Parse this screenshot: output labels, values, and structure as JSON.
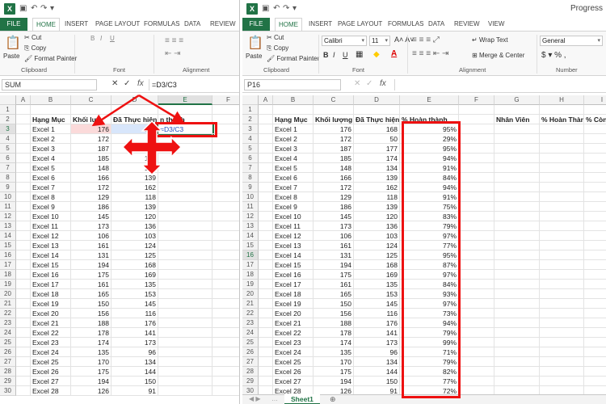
{
  "left": {
    "qa": [
      "↶",
      "↷",
      "▾"
    ],
    "tabs": [
      "FILE",
      "HOME",
      "INSERT",
      "PAGE LAYOUT",
      "FORMULAS",
      "DATA",
      "REVIEW"
    ],
    "clipboard": {
      "cut": "Cut",
      "copy": "Copy",
      "format_painter": "Format Painter",
      "paste": "Paste",
      "label": "Clipboard",
      "font_label": "Font"
    },
    "namebox": "SUM",
    "formula": "=D3/C3",
    "edit_text": "=D3/C3",
    "cols": [
      "A",
      "B",
      "C",
      "D",
      "E",
      "F"
    ],
    "header_row": [
      "Hạng Mục",
      "Khối lư",
      "Đã Thực hiện",
      "n thành"
    ],
    "alignment_label": "Alignment"
  },
  "right": {
    "title": "Progress",
    "tabs": [
      "FILE",
      "HOME",
      "INSERT",
      "PAGE LAYOUT",
      "FORMULAS",
      "DATA",
      "REVIEW",
      "VIEW"
    ],
    "clipboard": {
      "cut": "Cut",
      "copy": "Copy",
      "format_painter": "Format Painter",
      "paste": "Paste",
      "label": "Clipboard"
    },
    "font": {
      "name": "Calibri",
      "size": "11",
      "label": "Font",
      "bold": "B",
      "italic": "I",
      "underline": "U"
    },
    "alignment": {
      "wrap": "Wrap Text",
      "merge": "Merge & Center",
      "label": "Alignment"
    },
    "number": {
      "format": "General",
      "label": "Number",
      "symbols": "$ ▾ % ,"
    },
    "namebox": "P16",
    "cols": [
      "A",
      "B",
      "C",
      "D",
      "E",
      "F",
      "G",
      "H",
      "I"
    ],
    "header_row": [
      "Hạng Mục",
      "Khối lượng",
      "Đã Thực hiện",
      "% Hoàn thành",
      "Nhân Viên",
      "% Hoàn Thành",
      "% Còn lại"
    ],
    "sheet": "Sheet1",
    "plus": "⊕"
  },
  "rows": [
    {
      "name": "Excel 1",
      "vol": 176,
      "done": 168,
      "pct": "95%"
    },
    {
      "name": "Excel 2",
      "vol": 172,
      "done": 50,
      "pct": "29%"
    },
    {
      "name": "Excel 3",
      "vol": 187,
      "done": 177,
      "pct": "95%"
    },
    {
      "name": "Excel 4",
      "vol": 185,
      "done": 174,
      "pct": "94%"
    },
    {
      "name": "Excel 5",
      "vol": 148,
      "done": 134,
      "pct": "91%"
    },
    {
      "name": "Excel 6",
      "vol": 166,
      "done": 139,
      "pct": "84%"
    },
    {
      "name": "Excel 7",
      "vol": 172,
      "done": 162,
      "pct": "94%"
    },
    {
      "name": "Excel 8",
      "vol": 129,
      "done": 118,
      "pct": "91%"
    },
    {
      "name": "Excel 9",
      "vol": 186,
      "done": 139,
      "pct": "75%"
    },
    {
      "name": "Excel 10",
      "vol": 145,
      "done": 120,
      "pct": "83%"
    },
    {
      "name": "Excel 11",
      "vol": 173,
      "done": 136,
      "pct": "79%"
    },
    {
      "name": "Excel 12",
      "vol": 106,
      "done": 103,
      "pct": "97%"
    },
    {
      "name": "Excel 13",
      "vol": 161,
      "done": 124,
      "pct": "77%"
    },
    {
      "name": "Excel 14",
      "vol": 131,
      "done": 125,
      "pct": "95%"
    },
    {
      "name": "Excel 15",
      "vol": 194,
      "done": 168,
      "pct": "87%"
    },
    {
      "name": "Excel 16",
      "vol": 175,
      "done": 169,
      "pct": "97%"
    },
    {
      "name": "Excel 17",
      "vol": 161,
      "done": 135,
      "pct": "84%"
    },
    {
      "name": "Excel 18",
      "vol": 165,
      "done": 153,
      "pct": "93%"
    },
    {
      "name": "Excel 19",
      "vol": 150,
      "done": 145,
      "pct": "97%"
    },
    {
      "name": "Excel 20",
      "vol": 156,
      "done": 116,
      "pct": "73%"
    },
    {
      "name": "Excel 21",
      "vol": 188,
      "done": 176,
      "pct": "94%"
    },
    {
      "name": "Excel 22",
      "vol": 178,
      "done": 141,
      "pct": "79%"
    },
    {
      "name": "Excel 23",
      "vol": 174,
      "done": 173,
      "pct": "99%"
    },
    {
      "name": "Excel 24",
      "vol": 135,
      "done": 96,
      "pct": "71%"
    },
    {
      "name": "Excel 25",
      "vol": 170,
      "done": 134,
      "pct": "79%"
    },
    {
      "name": "Excel 26",
      "vol": 175,
      "done": 144,
      "pct": "82%"
    },
    {
      "name": "Excel 27",
      "vol": 194,
      "done": 150,
      "pct": "77%"
    },
    {
      "name": "Excel 28",
      "vol": 126,
      "done": 91,
      "pct": "72%"
    }
  ],
  "colors": {
    "excel_green": "#217346",
    "highlight_red": "#e11111"
  }
}
